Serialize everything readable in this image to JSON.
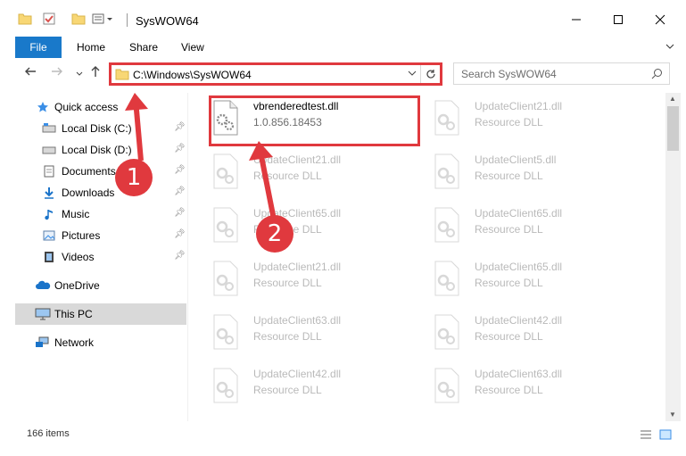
{
  "window": {
    "title": "SysWOW64"
  },
  "ribbon": {
    "tabs": [
      "File",
      "Home",
      "Share",
      "View"
    ]
  },
  "address": {
    "path": "C:\\Windows\\SysWOW64"
  },
  "search": {
    "placeholder": "Search SysWOW64"
  },
  "sidebar": {
    "items": [
      {
        "label": "Quick access",
        "icon": "star-icon"
      },
      {
        "label": "Local Disk (C:)",
        "icon": "drive-icon",
        "pinned": true
      },
      {
        "label": "Local Disk (D:)",
        "icon": "drive-icon",
        "pinned": true
      },
      {
        "label": "Documents",
        "icon": "document-icon",
        "pinned": true
      },
      {
        "label": "Downloads",
        "icon": "download-icon",
        "pinned": true
      },
      {
        "label": "Music",
        "icon": "music-icon",
        "pinned": true
      },
      {
        "label": "Pictures",
        "icon": "pictures-icon",
        "pinned": true
      },
      {
        "label": "Videos",
        "icon": "videos-icon",
        "pinned": true
      },
      {
        "label": "OneDrive",
        "icon": "cloud-icon"
      },
      {
        "label": "This PC",
        "icon": "computer-icon",
        "selected": true
      },
      {
        "label": "Network",
        "icon": "network-icon"
      }
    ]
  },
  "files": {
    "highlighted": {
      "name": "vbrenderedtest.dll",
      "desc": "1.0.856.18453"
    },
    "items": [
      {
        "name": "UpdateClient21.dll",
        "desc": "Resource DLL"
      },
      {
        "name": "UpdateClient21.dll",
        "desc": "Resource DLL"
      },
      {
        "name": "UpdateClient5.dll",
        "desc": "Resource DLL"
      },
      {
        "name": "UpdateClient65.dll",
        "desc": "Resource DLL"
      },
      {
        "name": "UpdateClient65.dll",
        "desc": "Resource DLL"
      },
      {
        "name": "UpdateClient21.dll",
        "desc": "Resource DLL"
      },
      {
        "name": "UpdateClient65.dll",
        "desc": "Resource DLL"
      },
      {
        "name": "UpdateClient63.dll",
        "desc": "Resource DLL"
      },
      {
        "name": "UpdateClient42.dll",
        "desc": "Resource DLL"
      },
      {
        "name": "UpdateClient42.dll",
        "desc": "Resource DLL"
      },
      {
        "name": "UpdateClient63.dll",
        "desc": "Resource DLL"
      }
    ]
  },
  "status": {
    "count": "166 items"
  },
  "annotations": {
    "step1": "1",
    "step2": "2"
  },
  "colors": {
    "accent": "#1979ca",
    "highlight": "#e0393e"
  }
}
